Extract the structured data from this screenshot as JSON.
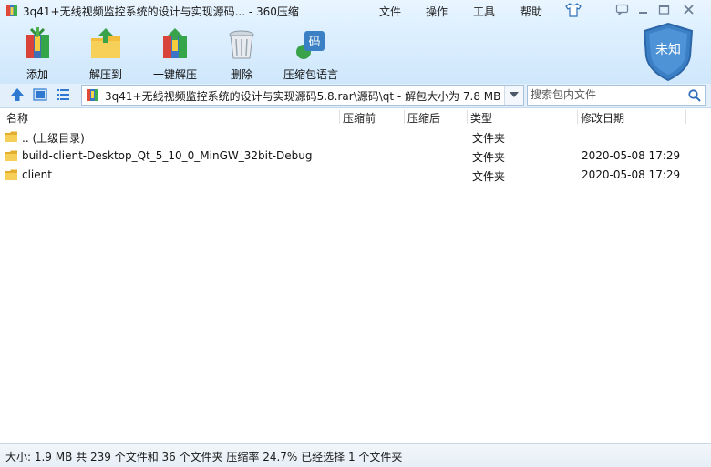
{
  "window": {
    "title": "3q41+无线视频监控系统的设计与实现源码... - 360压缩",
    "menu": [
      "文件",
      "操作",
      "工具",
      "帮助"
    ]
  },
  "toolbar": {
    "add": "添加",
    "extract_to": "解压到",
    "one_key_extract": "一键解压",
    "delete": "删除",
    "archive_language": "压缩包语言",
    "lang_glyph": "码"
  },
  "shield": {
    "label": "未知"
  },
  "address": {
    "path": "3q41+无线视频监控系统的设计与实现源码5.8.rar\\源码\\qt - 解包大小为 7.8 MB",
    "search_placeholder": "搜索包内文件"
  },
  "columns": {
    "name": "名称",
    "size_before": "压缩前",
    "size_after": "压缩后",
    "type": "类型",
    "modified": "修改日期"
  },
  "files": [
    {
      "name": ".. (上级目录)",
      "type": "文件夹",
      "modified": ""
    },
    {
      "name": "build-client-Desktop_Qt_5_10_0_MinGW_32bit-Debug",
      "type": "文件夹",
      "modified": "2020-05-08 17:29"
    },
    {
      "name": "client",
      "type": "文件夹",
      "modified": "2020-05-08 17:29"
    }
  ],
  "status": "大小: 1.9 MB 共 239 个文件和 36 个文件夹 压缩率 24.7% 已经选择 1 个文件夹",
  "colors": {
    "toolbar_bg": "#d9ecfd",
    "shield_blue": "#3b7fc4",
    "folder_yellow": "#f3c43c",
    "addr_bg": "#e3f0fc"
  }
}
